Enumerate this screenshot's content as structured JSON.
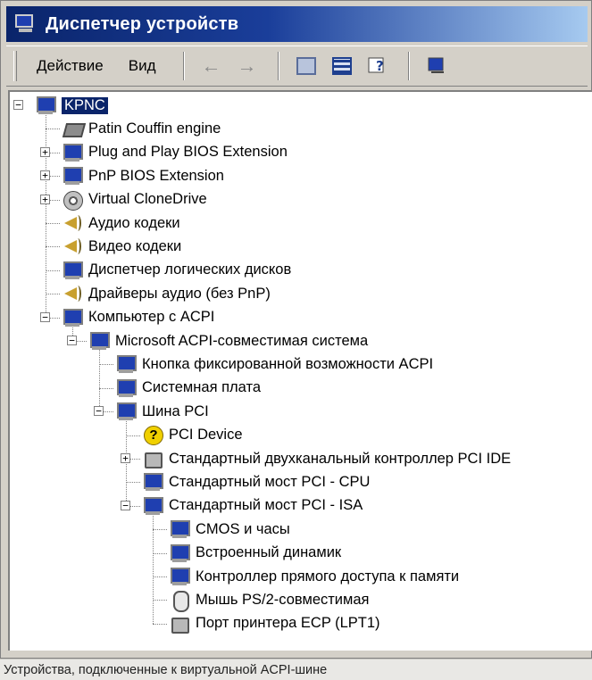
{
  "window": {
    "title": "Диспетчер устройств"
  },
  "toolbar": {
    "menu": [
      "Действие",
      "Вид"
    ],
    "buttons": [
      "back-arrow-icon",
      "forward-arrow-icon",
      "properties-icon",
      "view-icon",
      "help-icon",
      "refresh-icon"
    ]
  },
  "tree": [
    {
      "label": "KPNC",
      "icon": "computer-icon",
      "level": 0,
      "expander": "minus",
      "selected": true
    },
    {
      "label": "Patin Couffin engine",
      "icon": "chip-icon",
      "level": 1,
      "expander": "none"
    },
    {
      "label": "Plug and Play BIOS Extension",
      "icon": "monitor-icon",
      "level": 1,
      "expander": "plus"
    },
    {
      "label": "PnP BIOS Extension",
      "icon": "monitor-icon",
      "level": 1,
      "expander": "plus"
    },
    {
      "label": "Virtual CloneDrive",
      "icon": "disc-icon",
      "level": 1,
      "expander": "plus"
    },
    {
      "label": "Аудио кодеки",
      "icon": "speaker-icon",
      "level": 1,
      "expander": "none"
    },
    {
      "label": "Видео кодеки",
      "icon": "speaker-icon",
      "level": 1,
      "expander": "none"
    },
    {
      "label": "Диспетчер логических дисков",
      "icon": "monitor-icon",
      "level": 1,
      "expander": "none"
    },
    {
      "label": "Драйверы аудио (без PnP)",
      "icon": "speaker-icon",
      "level": 1,
      "expander": "none"
    },
    {
      "label": "Компьютер с ACPI",
      "icon": "monitor-icon",
      "level": 1,
      "expander": "minus"
    },
    {
      "label": "Microsoft ACPI-совместимая система",
      "icon": "monitor-icon",
      "level": 2,
      "expander": "minus"
    },
    {
      "label": "Кнопка фиксированной возможности ACPI",
      "icon": "monitor-icon",
      "level": 3,
      "expander": "none"
    },
    {
      "label": "Системная плата",
      "icon": "monitor-icon",
      "level": 3,
      "expander": "none"
    },
    {
      "label": "Шина PCI",
      "icon": "monitor-icon",
      "level": 3,
      "expander": "minus"
    },
    {
      "label": "PCI Device",
      "icon": "question-icon",
      "level": 4,
      "expander": "none"
    },
    {
      "label": "Стандартный двухканальный контроллер PCI IDE",
      "icon": "port-icon",
      "level": 4,
      "expander": "plus"
    },
    {
      "label": "Стандартный мост PCI - CPU",
      "icon": "monitor-icon",
      "level": 4,
      "expander": "none"
    },
    {
      "label": "Стандартный мост PCI - ISA",
      "icon": "monitor-icon",
      "level": 4,
      "expander": "minus"
    },
    {
      "label": "CMOS и часы",
      "icon": "monitor-icon",
      "level": 5,
      "expander": "none"
    },
    {
      "label": "Встроенный динамик",
      "icon": "monitor-icon",
      "level": 5,
      "expander": "none"
    },
    {
      "label": "Контроллер прямого доступа к памяти",
      "icon": "monitor-icon",
      "level": 5,
      "expander": "none"
    },
    {
      "label": "Мышь PS/2-совместимая",
      "icon": "mouse-icon",
      "level": 5,
      "expander": "none"
    },
    {
      "label": "Порт принтера ECP (LPT1)",
      "icon": "port-icon",
      "level": 5,
      "expander": "none"
    }
  ],
  "caption": "Устройства, подключенные к виртуальной ACPI-шине"
}
